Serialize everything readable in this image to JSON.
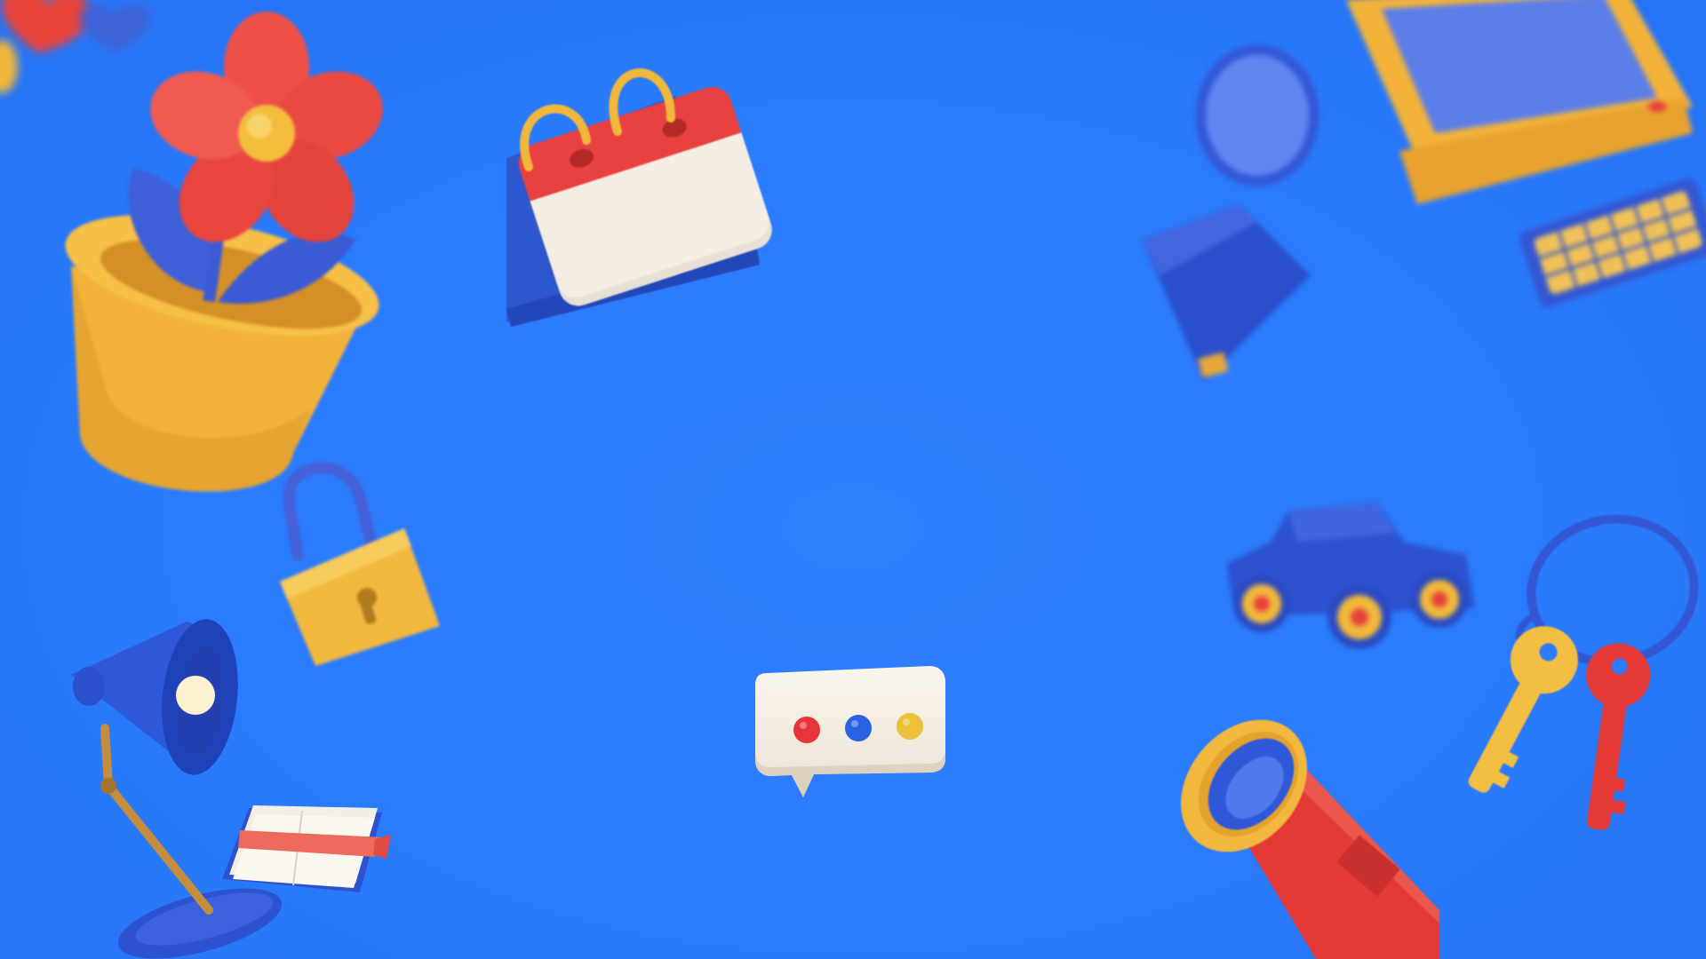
{
  "scene": {
    "background_color": "#2b7cff",
    "objects": [
      {
        "name": "flower-pot-icon"
      },
      {
        "name": "calendar-icon"
      },
      {
        "name": "magnifier-icon"
      },
      {
        "name": "retro-computer-icon"
      },
      {
        "name": "padlock-icon"
      },
      {
        "name": "desk-lamp-icon"
      },
      {
        "name": "open-book-icon"
      },
      {
        "name": "chat-bubble-icon"
      },
      {
        "name": "toy-car-icon"
      },
      {
        "name": "keys-icon"
      },
      {
        "name": "telescope-icon"
      },
      {
        "name": "heart-icon"
      }
    ],
    "chat_dots_colors": [
      "#e8343a",
      "#2a62e6",
      "#e9c23a"
    ]
  }
}
